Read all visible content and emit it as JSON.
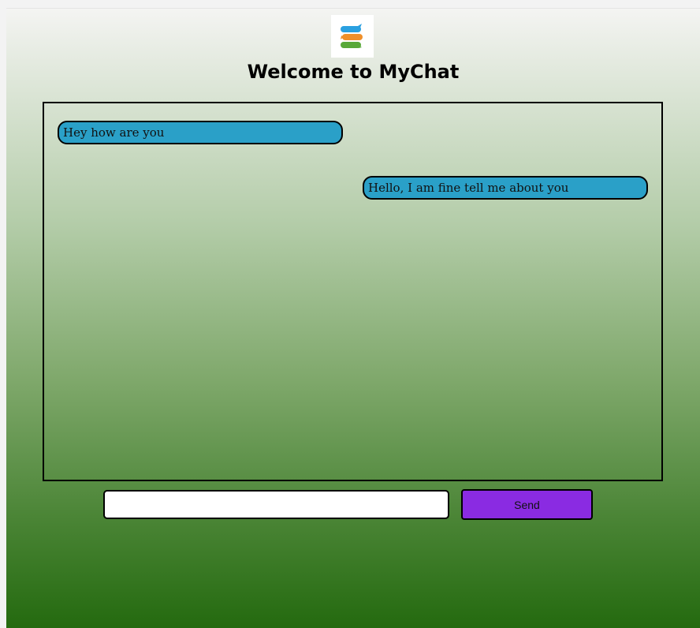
{
  "header": {
    "logo_icon": "stacked-chat-bubbles-logo-icon",
    "title": "Welcome to MyChat"
  },
  "chat": {
    "messages": [
      {
        "side": "left",
        "text": "Hey how are you"
      },
      {
        "side": "right",
        "text": "Hello, I am fine tell me about you"
      }
    ]
  },
  "composer": {
    "input_value": "",
    "send_label": "Send"
  },
  "colors": {
    "bubble": "#2aa0c8",
    "send_button": "#8a2be2",
    "gradient_top": "#f4f4f2",
    "gradient_bottom": "#246a0f"
  }
}
